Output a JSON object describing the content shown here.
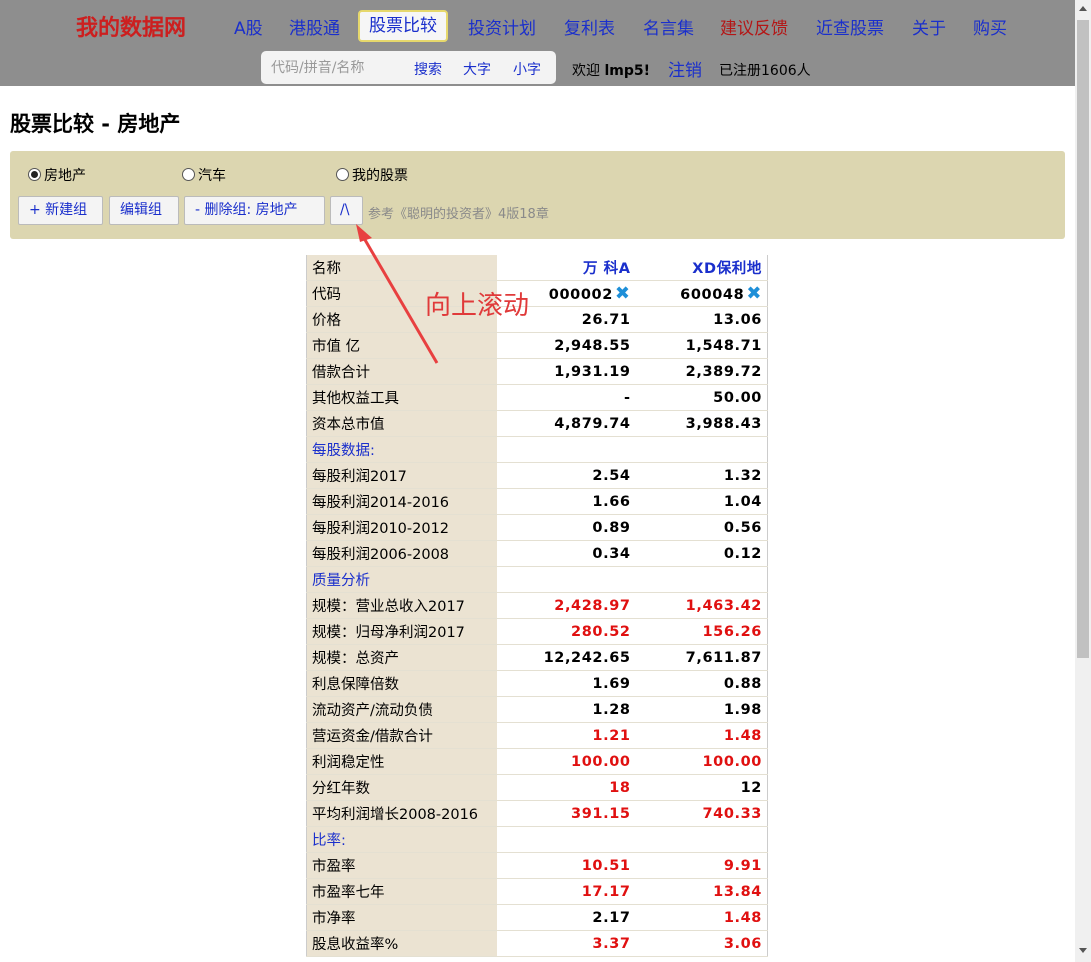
{
  "header": {
    "brand": "我的数据网",
    "nav": [
      "A股",
      "港股通",
      "股票比较",
      "投资计划",
      "复利表",
      "名言集",
      "建议反馈",
      "近查股票",
      "关于",
      "购买"
    ],
    "search_placeholder": "代码/拼音/名称",
    "search_label": "搜索",
    "large_font_label": "大字",
    "small_font_label": "小字",
    "welcome_prefix": "欢迎",
    "username": "lmp5!",
    "logout_label": "注销",
    "registered_text": "已注册1606人"
  },
  "page": {
    "title": "股票比较 - 房地产",
    "groups": [
      "房地产",
      "汽车",
      "我的股票"
    ],
    "selected_group": "房地产",
    "new_group_label": "+ 新建组",
    "edit_group_label": "编辑组",
    "delete_group_label": "- 删除组: 房地产",
    "scroll_up_label": "/\\",
    "hint": "参考《聪明的投资者》4版18章"
  },
  "annotation": {
    "text": "向上滚动",
    "color": "#e03a3a"
  },
  "colors": {
    "link": "#1a2fcc",
    "highlight_value": "#e01010",
    "brand": "#cc1f1f",
    "label_column": "#ebe3d2",
    "group_box": "#dcd6b0"
  },
  "table": {
    "name_header": "名称",
    "stocks": [
      {
        "name": "万 科A",
        "code": "000002"
      },
      {
        "name": "XD保利地",
        "code": "600048"
      }
    ],
    "rows": [
      {
        "label": "代码",
        "type": "code"
      },
      {
        "label": "价格",
        "values": [
          "26.71",
          "13.06"
        ],
        "red": [
          false,
          false
        ]
      },
      {
        "label": "市值 亿",
        "values": [
          "2,948.55",
          "1,548.71"
        ],
        "red": [
          false,
          false
        ]
      },
      {
        "label": "借款合计",
        "values": [
          "1,931.19",
          "2,389.72"
        ],
        "red": [
          false,
          false
        ]
      },
      {
        "label": "其他权益工具",
        "values": [
          "-",
          "50.00"
        ],
        "red": [
          false,
          false
        ]
      },
      {
        "label": "资本总市值",
        "values": [
          "4,879.74",
          "3,988.43"
        ],
        "red": [
          false,
          false
        ]
      },
      {
        "label": "每股数据:",
        "type": "section"
      },
      {
        "label": "每股利润2017",
        "values": [
          "2.54",
          "1.32"
        ],
        "red": [
          false,
          false
        ]
      },
      {
        "label": "每股利润2014-2016",
        "values": [
          "1.66",
          "1.04"
        ],
        "red": [
          false,
          false
        ]
      },
      {
        "label": "每股利润2010-2012",
        "values": [
          "0.89",
          "0.56"
        ],
        "red": [
          false,
          false
        ]
      },
      {
        "label": "每股利润2006-2008",
        "values": [
          "0.34",
          "0.12"
        ],
        "red": [
          false,
          false
        ]
      },
      {
        "label": "质量分析",
        "type": "section"
      },
      {
        "label": "规模：营业总收入2017",
        "values": [
          "2,428.97",
          "1,463.42"
        ],
        "red": [
          true,
          true
        ]
      },
      {
        "label": "规模：归母净利润2017",
        "values": [
          "280.52",
          "156.26"
        ],
        "red": [
          true,
          true
        ]
      },
      {
        "label": "规模：总资产",
        "values": [
          "12,242.65",
          "7,611.87"
        ],
        "red": [
          false,
          false
        ]
      },
      {
        "label": "利息保障倍数",
        "values": [
          "1.69",
          "0.88"
        ],
        "red": [
          false,
          false
        ]
      },
      {
        "label": "流动资产/流动负债",
        "values": [
          "1.28",
          "1.98"
        ],
        "red": [
          false,
          false
        ]
      },
      {
        "label": "营运资金/借款合计",
        "values": [
          "1.21",
          "1.48"
        ],
        "red": [
          true,
          true
        ]
      },
      {
        "label": "利润稳定性",
        "values": [
          "100.00",
          "100.00"
        ],
        "red": [
          true,
          true
        ]
      },
      {
        "label": "分红年数",
        "values": [
          "18",
          "12"
        ],
        "red": [
          true,
          false
        ]
      },
      {
        "label": "平均利润增长2008-2016",
        "values": [
          "391.15",
          "740.33"
        ],
        "red": [
          true,
          true
        ]
      },
      {
        "label": "比率:",
        "type": "section"
      },
      {
        "label": "市盈率",
        "values": [
          "10.51",
          "9.91"
        ],
        "red": [
          true,
          true
        ]
      },
      {
        "label": "市盈率七年",
        "values": [
          "17.17",
          "13.84"
        ],
        "red": [
          true,
          true
        ]
      },
      {
        "label": "市净率",
        "values": [
          "2.17",
          "1.48"
        ],
        "red": [
          false,
          true
        ]
      },
      {
        "label": "股息收益率%",
        "values": [
          "3.37",
          "3.06"
        ],
        "red": [
          true,
          true
        ]
      }
    ]
  }
}
